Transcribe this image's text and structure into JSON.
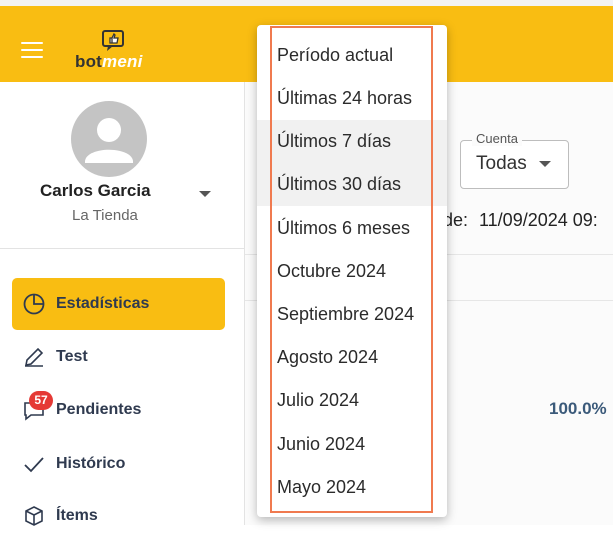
{
  "header": {
    "logo_bot": "bot",
    "logo_meni": "meni",
    "accent_color": "#f9bd12"
  },
  "user": {
    "name": "Carlos Garcia",
    "store": "La Tienda"
  },
  "nav": {
    "items": [
      {
        "label": "Estadísticas",
        "icon": "pie-chart-icon",
        "active": true
      },
      {
        "label": "Test",
        "icon": "pencil-icon",
        "active": false
      },
      {
        "label": "Pendientes",
        "icon": "chat-icon",
        "active": false,
        "badge": "57"
      },
      {
        "label": "Histórico",
        "icon": "check-icon",
        "active": false
      },
      {
        "label": "Ítems",
        "icon": "box-icon",
        "active": false
      }
    ]
  },
  "filters": {
    "cuenta_label": "Cuenta",
    "cuenta_value": "Todas",
    "date_prefix": "de:",
    "date_value": "11/09/2024 09:"
  },
  "stats": {
    "paren": ")",
    "percent": "100.0%"
  },
  "period_menu": {
    "options": [
      "Período actual",
      "Últimas 24 horas",
      "Últimos 7 días",
      "Últimos 30 días",
      "Últimos 6 meses",
      "Octubre 2024",
      "Septiembre 2024",
      "Agosto 2024",
      "Julio 2024",
      "Junio 2024",
      "Mayo 2024"
    ],
    "highlight_color": "#f07a4f"
  }
}
